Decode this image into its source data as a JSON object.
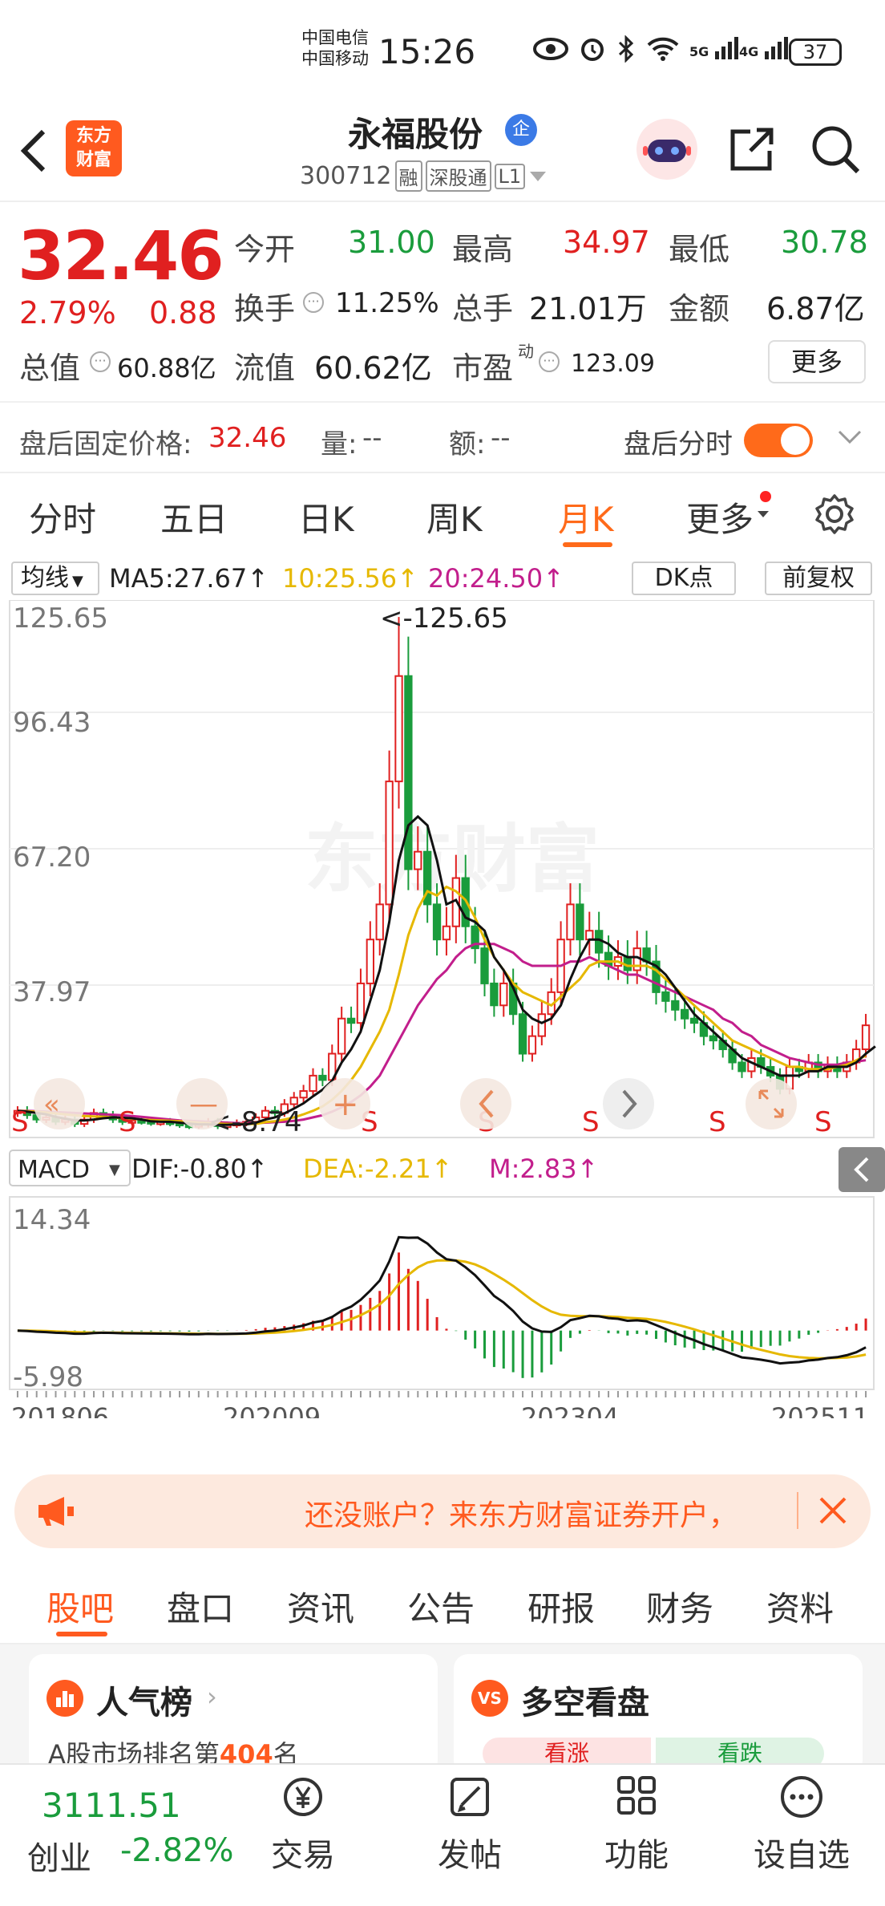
{
  "status_bar": {
    "carrier1": "中国电信",
    "carrier2": "中国移动",
    "time": "15:26",
    "sig1_label": "5G",
    "sig2_label": "4G",
    "battery": "37"
  },
  "header": {
    "logo_line1": "东方",
    "logo_line2": "财富",
    "stock_name": "永福股份",
    "badge": "企",
    "code": "300712",
    "tag1": "融",
    "tag2": "深股通",
    "tag3": "L1"
  },
  "quote": {
    "price": "32.46",
    "change_pct": "2.79%",
    "change": "0.88",
    "open_label": "今开",
    "open": "31.00",
    "high_label": "最高",
    "high": "34.97",
    "low_label": "最低",
    "low": "30.78",
    "turnover_label": "换手",
    "turnover": "11.25%",
    "volume_label": "总手",
    "volume": "21.01万",
    "amount_label": "金额",
    "amount": "6.87亿",
    "mktcap_label": "总值",
    "mktcap": "60.88亿",
    "float_label": "流值",
    "float": "60.62亿",
    "pe_label": "市盈",
    "pe_sup": "动",
    "pe": "123.09",
    "more": "更多"
  },
  "after_hours": {
    "price_label": "盘后固定价格:",
    "price": "32.46",
    "vol_label": "量:",
    "vol": "--",
    "amt_label": "额:",
    "amt": "--",
    "toggle_label": "盘后分时"
  },
  "tabs": [
    "分时",
    "五日",
    "日K",
    "周K",
    "月K",
    "更多"
  ],
  "active_tab": "月K",
  "chart_legend": {
    "ma_select": "均线",
    "ma5": "MA5:27.67↑",
    "ma10": "10:25.56↑",
    "ma20": "20:24.50↑",
    "dk": "DK点",
    "adjust": "前复权"
  },
  "macd_legend": {
    "select": "MACD",
    "dif": "DIF:-0.80↑",
    "dea": "DEA:-2.21↑",
    "m": "M:2.83↑"
  },
  "ad": {
    "text": "还没账户？来东方财富证券开户，"
  },
  "subtabs": [
    "股吧",
    "盘口",
    "资讯",
    "公告",
    "研报",
    "财务",
    "资料"
  ],
  "cards": {
    "left_title": "人气榜",
    "left_sub": "A股市场排名第",
    "left_rank": "404",
    "left_unit": "名",
    "right_title": "多空看盘",
    "right_a": "看涨",
    "right_b": "看跌"
  },
  "bottom_nav": {
    "index_value": "3111.51",
    "index_name": "创业",
    "index_change": "-2.82%",
    "trade": "交易",
    "post": "发帖",
    "func": "功能",
    "watch": "设自选"
  },
  "chart_data": [
    {
      "type": "candlestick",
      "title": "永福股份 月K",
      "y_ticks": [
        "125.65",
        "96.43",
        "67.20",
        "37.97"
      ],
      "y_range": [
        8.74,
        125.65
      ],
      "x_ticks": [
        "201806",
        "202009",
        "202304",
        "202511"
      ],
      "annotations": [
        "<-125.65",
        "<-8.74"
      ],
      "signals": [
        "S",
        "S",
        "S",
        "S",
        "S",
        "S",
        "S"
      ],
      "colors": {
        "up": "#e02020",
        "down": "#1a9c3c",
        "ma5": "#111111",
        "ma10": "#e6b800",
        "ma20": "#c21e8c"
      },
      "months": [
        "2018-06",
        "2018-07",
        "2018-08",
        "2018-09",
        "2018-10",
        "2018-11",
        "2018-12",
        "2019-01",
        "2019-02",
        "2019-03",
        "2019-04",
        "2019-05",
        "2019-06",
        "2019-07",
        "2019-08",
        "2019-09",
        "2019-10",
        "2019-11",
        "2019-12",
        "2020-01",
        "2020-02",
        "2020-03",
        "2020-04",
        "2020-05",
        "2020-06",
        "2020-07",
        "2020-08",
        "2020-09",
        "2020-10",
        "2020-11",
        "2020-12",
        "2021-01",
        "2021-02",
        "2021-03",
        "2021-04",
        "2021-05",
        "2021-06",
        "2021-07",
        "2021-08",
        "2021-09",
        "2021-10",
        "2021-11",
        "2021-12",
        "2022-01",
        "2022-02",
        "2022-03",
        "2022-04",
        "2022-05",
        "2022-06",
        "2022-07",
        "2022-08",
        "2022-09",
        "2022-10",
        "2022-11",
        "2022-12",
        "2023-01",
        "2023-02",
        "2023-03",
        "2023-04",
        "2023-05",
        "2023-06",
        "2023-07",
        "2023-08",
        "2023-09",
        "2023-10",
        "2023-11",
        "2023-12",
        "2024-01",
        "2024-02",
        "2024-03",
        "2024-04",
        "2024-05",
        "2024-06",
        "2024-07",
        "2024-08",
        "2024-09",
        "2024-10",
        "2024-11",
        "2024-12",
        "2025-01",
        "2025-02",
        "2025-03",
        "2025-04",
        "2025-05",
        "2025-06",
        "2025-07",
        "2025-08",
        "2025-09",
        "2025-10",
        "2025-11"
      ],
      "close": [
        13,
        12,
        11,
        11.5,
        10.5,
        11,
        10,
        11,
        12.5,
        12,
        11,
        10.5,
        10.8,
        10.6,
        10.3,
        10.5,
        10.2,
        9.8,
        9.5,
        9.9,
        10.5,
        9.5,
        9.8,
        10.2,
        10.5,
        11.5,
        13,
        12.5,
        14.5,
        16,
        17.5,
        21,
        20,
        26,
        34,
        33,
        42,
        52,
        60,
        88,
        112,
        68,
        72,
        60,
        52,
        55,
        66,
        55,
        50,
        42,
        37,
        42,
        35,
        26,
        30,
        35,
        40,
        52,
        60,
        52,
        54,
        49,
        46,
        48,
        45,
        50,
        47,
        40,
        38,
        36,
        34,
        33,
        30,
        29,
        27,
        24,
        22,
        25,
        23,
        21,
        18,
        23,
        22,
        24,
        22,
        23.5,
        22,
        24,
        27,
        32.46
      ],
      "ma5": [
        13,
        12.8,
        12.5,
        12.2,
        11.6,
        11.2,
        10.8,
        10.8,
        11,
        11.3,
        11.5,
        11.4,
        11.3,
        11,
        10.6,
        10.5,
        10.5,
        10.3,
        10.1,
        9.9,
        9.9,
        9.8,
        9.8,
        9.9,
        9.9,
        10.3,
        11,
        11.5,
        12.4,
        13.5,
        14.7,
        16.3,
        17.8,
        19.8,
        24,
        27,
        31,
        38,
        45,
        56,
        70,
        78,
        80,
        78,
        70,
        60,
        61,
        57,
        56,
        54,
        48,
        45,
        41,
        36,
        34,
        33,
        34,
        37,
        43,
        48,
        52,
        52,
        51,
        49,
        48,
        48,
        47,
        46,
        44,
        41,
        38,
        35,
        33,
        31,
        29,
        27,
        25,
        24,
        23,
        22,
        21,
        21,
        21,
        22,
        22,
        23,
        23,
        23,
        24,
        26,
        27.67
      ],
      "ma10": [
        13,
        12.9,
        12.8,
        12.6,
        12.4,
        12.2,
        12,
        11.8,
        11.7,
        11.6,
        11.5,
        11.3,
        11.2,
        11,
        10.9,
        10.8,
        10.7,
        10.6,
        10.5,
        10.3,
        10.2,
        10.1,
        10,
        10,
        10,
        10,
        10.4,
        10.6,
        11,
        11.5,
        12.2,
        13,
        14,
        15.5,
        17.5,
        20,
        23,
        27,
        31,
        36,
        44,
        53,
        59,
        63,
        62,
        64,
        63,
        61,
        57,
        52,
        48,
        45,
        42,
        40,
        39,
        38,
        37,
        39,
        41,
        43,
        46,
        47,
        47,
        47,
        46,
        46,
        46,
        45,
        43,
        41,
        39,
        37,
        35,
        33,
        31,
        29,
        28,
        27,
        26,
        25,
        24,
        23,
        23,
        22.5,
        22.5,
        22.5,
        23,
        23.5,
        24.5,
        25.56
      ],
      "ma20": [
        13,
        13,
        12.9,
        12.8,
        12.7,
        12.6,
        12.5,
        12.4,
        12.3,
        12.2,
        12.1,
        12,
        11.8,
        11.6,
        11.4,
        11.2,
        11,
        10.8,
        10.7,
        10.6,
        10.5,
        10.4,
        10.3,
        10.2,
        10.2,
        10.2,
        10.3,
        10.4,
        10.5,
        10.7,
        11,
        11.5,
        12,
        12.8,
        13.8,
        15,
        16.5,
        18.5,
        21,
        25,
        29,
        33,
        37,
        40,
        43,
        45,
        48,
        50,
        51,
        51,
        51,
        50,
        49,
        47,
        46,
        46,
        46,
        46,
        47,
        47,
        48,
        47,
        46,
        45,
        44,
        44,
        43,
        42,
        41,
        40,
        39,
        38,
        37,
        36,
        34,
        33,
        31,
        30,
        28,
        27,
        26,
        25,
        24.5,
        24,
        23.5,
        23.5,
        23.5,
        24,
        24.2,
        24.5
      ],
      "macd_y_ticks": [
        "14.34",
        "-5.98"
      ],
      "macd_range": [
        -5.98,
        14.34
      ],
      "dif_last": -0.8,
      "dea_last": -2.21,
      "m_last": 2.83
    }
  ]
}
